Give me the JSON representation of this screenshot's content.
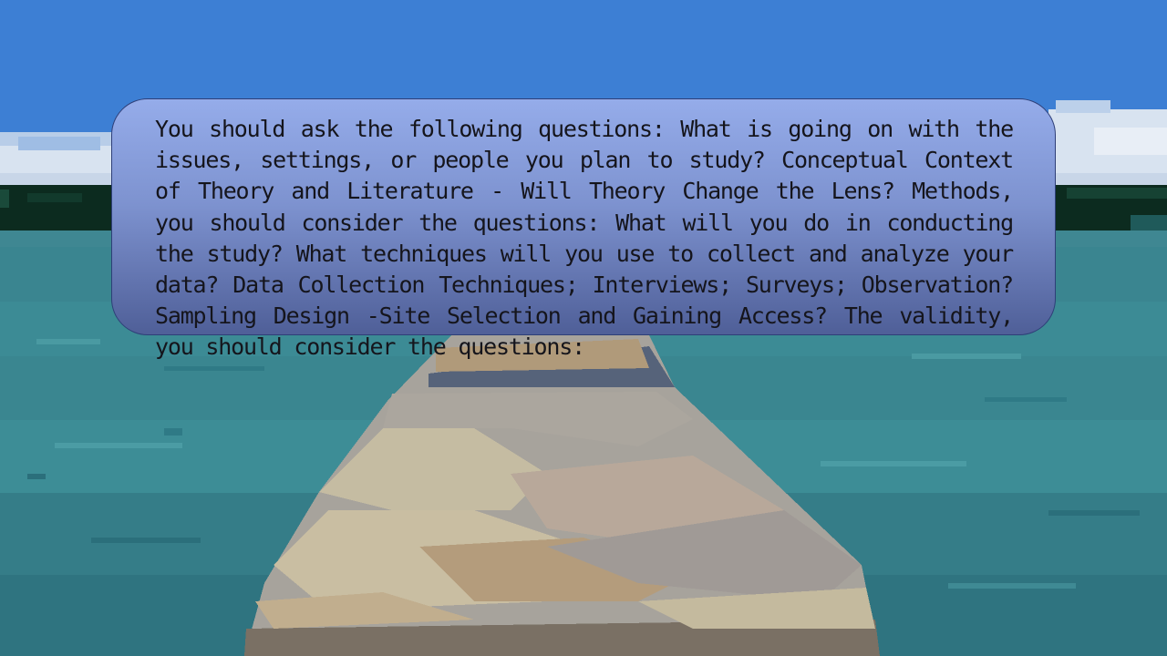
{
  "dialog": {
    "text": "You should ask the following questions: What is going on with the issues, settings, or people you plan to study? Conceptual Context of Theory and Literature - Will Theory Change the Lens? Methods, you should consider the questions:  What will you do in conducting the study? What techniques will you use to collect and analyze your data? Data Collection Techniques; Interviews; Surveys; Observation? Sampling Design -Site Selection and Gaining Access?  The validity, you should consider the questions:"
  },
  "colors": {
    "sky": "#3d7fd4",
    "water": "#3b8a92",
    "treeline": "#0c2b1f",
    "dock": "#a7a39c",
    "dialog_top": "#95acea",
    "dialog_bottom": "#4f5f98",
    "text": "#15151c"
  }
}
